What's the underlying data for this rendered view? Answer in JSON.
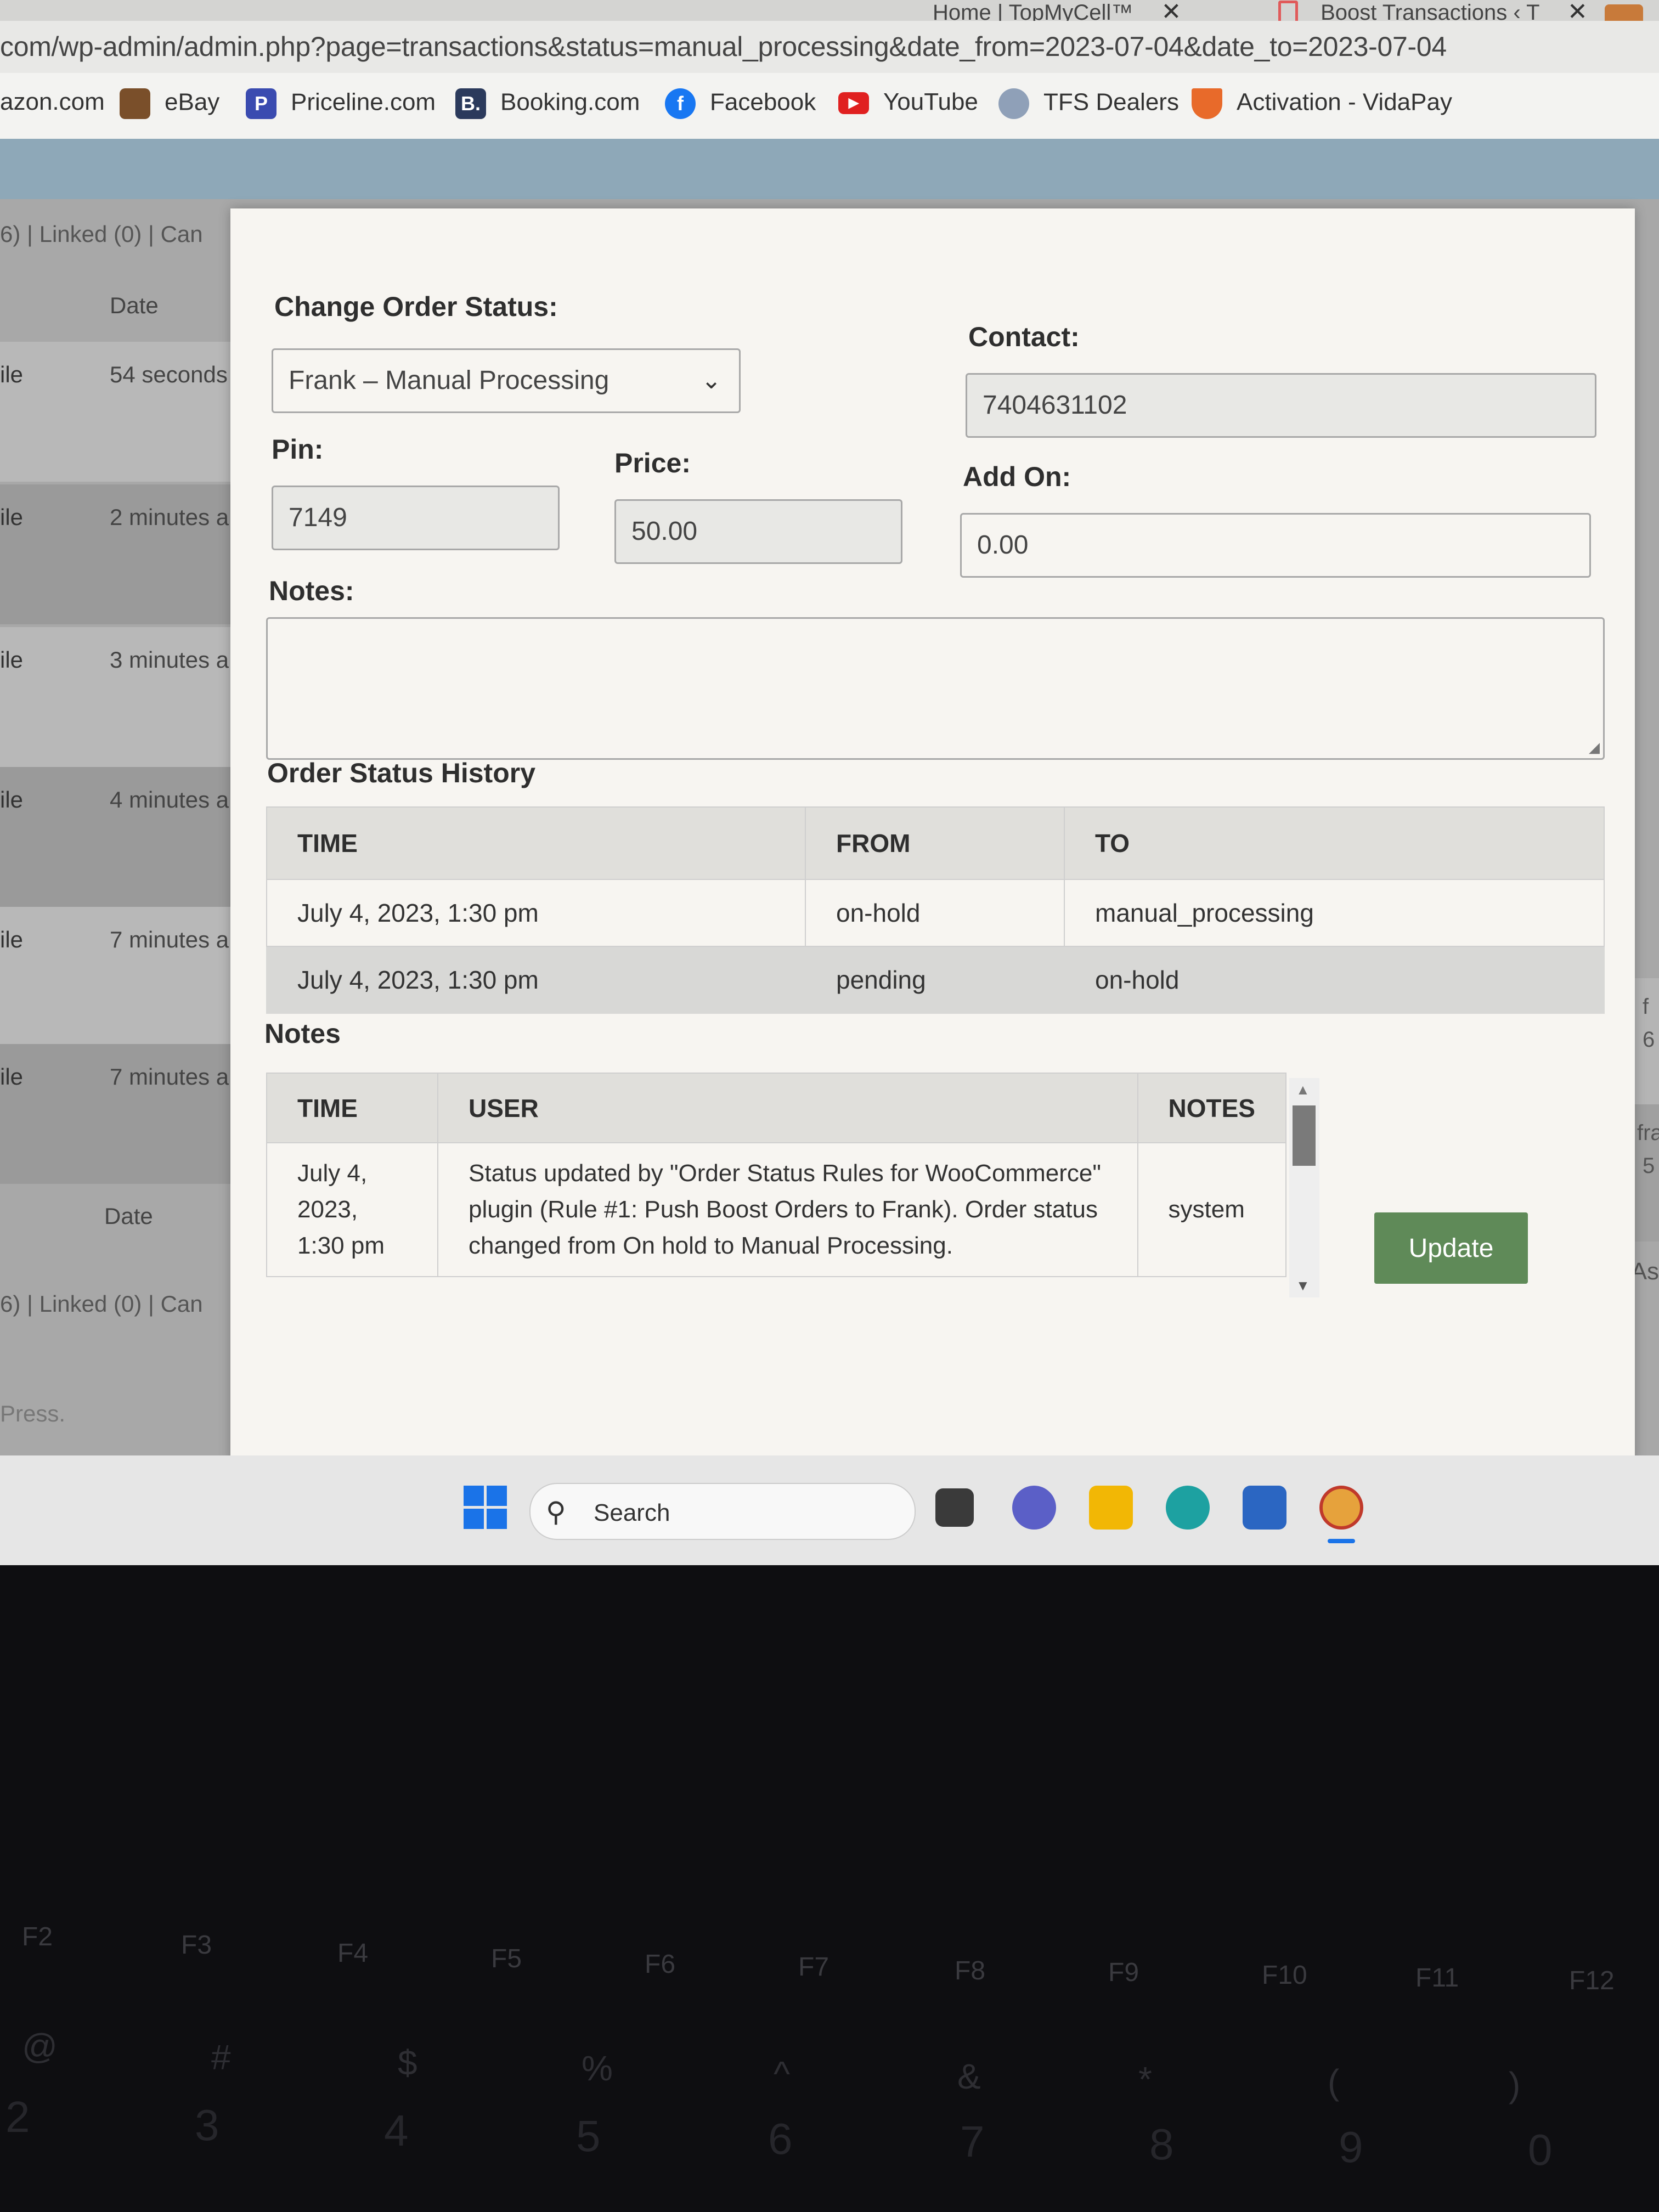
{
  "browser": {
    "tabs": [
      {
        "label": "Home | TopMyCell™",
        "close": "✕"
      },
      {
        "label": "Boost Transactions ‹ T",
        "close": "✕"
      }
    ],
    "url": "com/wp-admin/admin.php?page=transactions&status=manual_processing&date_from=2023-07-04&date_to=2023-07-04",
    "bookmarks": [
      "azon.com",
      "eBay",
      "Priceline.com",
      "Booking.com",
      "Facebook",
      "YouTube",
      "TFS Dealers",
      "Activation - VidaPay"
    ]
  },
  "background": {
    "links_text": "6) | Linked (0) | Can",
    "date_header": "Date",
    "rows": [
      {
        "status": "ile",
        "time": "54 seconds"
      },
      {
        "status": "ile",
        "time": "2 minutes a"
      },
      {
        "status": "ile",
        "time": "3 minutes a"
      },
      {
        "status": "ile",
        "time": "4 minutes a"
      },
      {
        "status": "ile",
        "time": "7 minutes a"
      },
      {
        "status": "ile",
        "time": "7 minutes a"
      }
    ],
    "footer_text": "Press.",
    "right_fragments": [
      "f",
      "6",
      "fra",
      "5",
      "As"
    ]
  },
  "modal": {
    "change_status": {
      "label": "Change Order Status:",
      "value": "Frank – Manual Processing"
    },
    "contact": {
      "label": "Contact:",
      "value": "7404631102"
    },
    "pin": {
      "label": "Pin:",
      "value": "7149"
    },
    "price": {
      "label": "Price:",
      "value": "50.00"
    },
    "add_on": {
      "label": "Add On:",
      "value": "0.00"
    },
    "notes_field": {
      "label": "Notes:",
      "value": ""
    },
    "history": {
      "title": "Order Status History",
      "columns": [
        "TIME",
        "FROM",
        "TO"
      ],
      "rows": [
        {
          "time": "July 4, 2023, 1:30 pm",
          "from": "on-hold",
          "to": "manual_processing"
        },
        {
          "time": "July 4, 2023, 1:30 pm",
          "from": "pending",
          "to": "on-hold"
        }
      ]
    },
    "notes": {
      "title": "Notes",
      "columns": [
        "TIME",
        "USER",
        "NOTES"
      ],
      "rows": [
        {
          "time": "July 4, 2023, 1:30 pm",
          "user": "Status updated by \"Order Status Rules for WooCommerce\" plugin (Rule #1: Push Boost Orders to Frank). Order status changed from On hold to Manual Processing.",
          "notes": "system"
        }
      ]
    },
    "update_button": "Update"
  },
  "taskbar": {
    "search_placeholder": "Search",
    "apps": [
      "task-view",
      "meet-chat",
      "file-explorer",
      "edge",
      "store",
      "chrome-canary"
    ]
  },
  "keyboard": {
    "fkeys": [
      "F2",
      "F3",
      "F4",
      "F5",
      "F6",
      "F7",
      "F8",
      "F9",
      "F10",
      "F11",
      "F12"
    ],
    "symbols": [
      "@",
      "#",
      "$",
      "%",
      "^",
      "&",
      "*",
      "(",
      ")"
    ],
    "numbers": [
      "2",
      "3",
      "4",
      "5",
      "6",
      "7",
      "8",
      "9",
      "0"
    ]
  },
  "colors": {
    "update_button": "#5f8a58",
    "alt_row": "#d8d8d6",
    "modal_bg": "#f7f5f1"
  }
}
